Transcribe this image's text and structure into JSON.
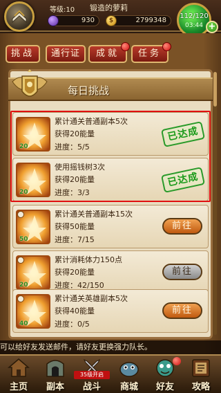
{
  "header": {
    "level_text": "等级:10",
    "player_name": "锻造的萝莉",
    "gems": "930",
    "gold": "2799348",
    "energy": "112/120",
    "energy_timer": "03:44",
    "plus_label": "+"
  },
  "tabs": [
    {
      "label": "挑战",
      "has_dot": false
    },
    {
      "label": "通行证",
      "has_dot": false
    },
    {
      "label": "成就",
      "has_dot": true
    },
    {
      "label": "任务",
      "has_dot": true
    }
  ],
  "panel": {
    "title": "每日挑战"
  },
  "tasks": [
    {
      "title": "累计通关普通副本5次",
      "reward": "获得20能量",
      "progress": "进度：5/5",
      "level": "20",
      "status": "done",
      "status_label": "已达成"
    },
    {
      "title": "使用摇钱树3次",
      "reward": "获得20能量",
      "progress": "进度：3/3",
      "level": "20",
      "status": "done",
      "status_label": "已达成"
    },
    {
      "title": "累计通关普通副本15次",
      "reward": "获得50能量",
      "progress": "进度：7/15",
      "level": "50",
      "status": "go",
      "status_label": "前往"
    },
    {
      "title": "累计消耗体力150点",
      "reward": "获得20能量",
      "progress": "进度：42/150",
      "level": "20",
      "status": "go-gray",
      "status_label": "前往"
    },
    {
      "title": "累计通关英雄副本5次",
      "reward": "获得40能量",
      "progress": "进度：0/5",
      "level": "40",
      "status": "go",
      "status_label": "前往"
    }
  ],
  "marquee_text": "可以给好友发送邮件，请好友更换强力队长。",
  "battle_open_label": "35级开启",
  "nav": [
    {
      "label": "主页",
      "icon": "home-icon"
    },
    {
      "label": "副本",
      "icon": "dungeon-icon"
    },
    {
      "label": "战斗",
      "icon": "battle-icon"
    },
    {
      "label": "商城",
      "icon": "shop-icon"
    },
    {
      "label": "好友",
      "icon": "friends-icon"
    },
    {
      "label": "攻略",
      "icon": "guide-icon"
    }
  ],
  "colors": {
    "accent_red": "#b83a2a",
    "parchment": "#e9dcc0",
    "done_green": "#1a9a1a",
    "go_orange": "#c05a10"
  }
}
